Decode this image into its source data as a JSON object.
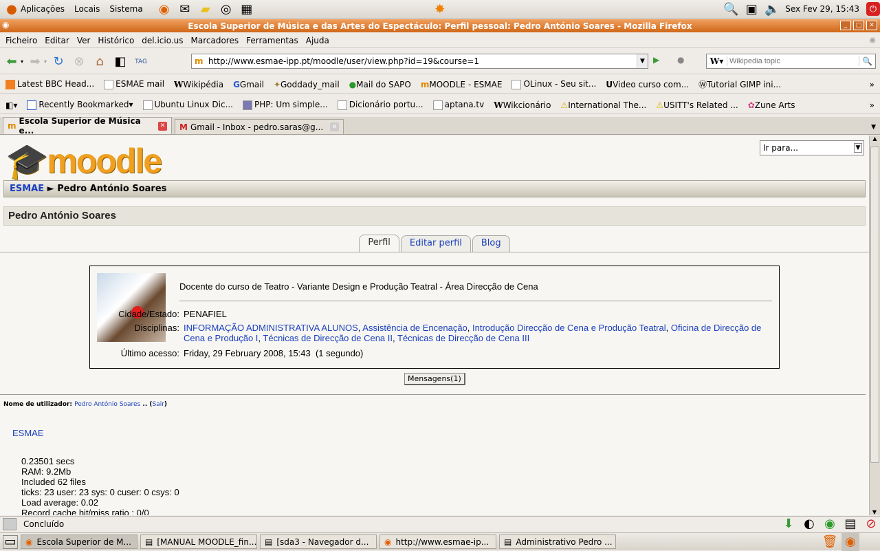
{
  "panel": {
    "menus": [
      "Aplicações",
      "Locais",
      "Sistema"
    ],
    "clock": "Sex Fev 29, 15:43"
  },
  "window": {
    "title": "Escola Superior de Música e das Artes do Espectáculo: Perfil pessoal: Pedro António Soares - Mozilla Firefox"
  },
  "menubar": [
    "Ficheiro",
    "Editar",
    "Ver",
    "Histórico",
    "del.icio.us",
    "Marcadores",
    "Ferramentas",
    "Ajuda"
  ],
  "navbar": {
    "url": "http://www.esmae-ipp.pt/moodle/user/view.php?id=19&course=1",
    "search_placeholder": "Wikipedia topic"
  },
  "bookmarks1": [
    "Latest BBC Head...",
    "ESMAE mail",
    "Wikipédia",
    "Gmail",
    "Goddady_mail",
    "Mail do SAPO",
    "MOODLE - ESMAE",
    "OLinux - Seu sit...",
    "Video curso com...",
    "Tutorial GIMP ini..."
  ],
  "bookmarks2": [
    "Recently Bookmarked",
    "Ubuntu Linux Dic...",
    "PHP: Um simple...",
    "Dicionário portu...",
    "aptana.tv",
    "Wikcionário",
    "International The...",
    "USITT's Related ...",
    "Zune Arts"
  ],
  "tabs": [
    "Escola Superior de Música e...",
    "Gmail - Inbox - pedro.saras@g..."
  ],
  "page": {
    "logo": "moodle",
    "jump": "Ir para...",
    "breadcrumb": {
      "home": "ESMAE",
      "sep": "►",
      "current": "Pedro António Soares"
    },
    "heading": "Pedro António Soares",
    "profile_tabs": [
      "Perfil",
      "Editar perfil",
      "Blog"
    ],
    "description": "Docente do curso de Teatro - Variante Design e Produção Teatral - Área Direcção de Cena",
    "city_label": "Cidade/Estado:",
    "city": "PENAFIEL",
    "courses_label": "Disciplinas:",
    "courses": [
      "INFORMAÇÃO ADMINISTRATIVA ALUNOS",
      "Assistência de Encenação",
      "Introdução Direcção de Cena e Produção Teatral",
      "Oficina de Direcção de Cena e Produção I",
      "Técnicas de Direcção de Cena II",
      "Técnicas de Direcção de Cena III"
    ],
    "access_label": "Último acesso:",
    "access": "Friday, 29 February 2008, 15:43  (1 segundo)",
    "messages_button": "Mensagens(1)",
    "login_label": "Nome de utilizador:",
    "login_user": "Pedro António Soares",
    "login_logout": "Sair",
    "footer_link": "ESMAE",
    "perf": [
      "0.23501 secs",
      "RAM: 9.2Mb",
      "Included 62 files",
      "ticks: 23 user: 23 sys: 0 cuser: 0 csys: 0",
      "Load average: 0.02",
      "Record cache hit/miss ratio : 0/0"
    ]
  },
  "status": "Concluído",
  "taskbar": [
    "Escola Superior de M...",
    "[MANUAL MOODLE_fin...",
    "[sda3 - Navegador d...",
    "http://www.esmae-ip...",
    "Administrativo Pedro ..."
  ]
}
